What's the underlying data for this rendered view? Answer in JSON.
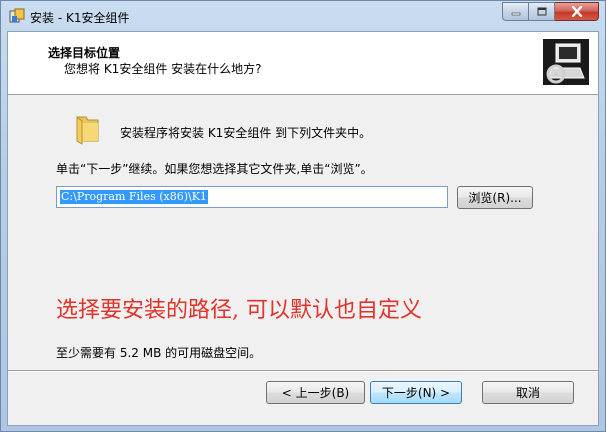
{
  "window": {
    "title": "安装 - K1安全组件",
    "icon": "setup-icon",
    "controls": [
      "minimize-icon",
      "maximize-icon",
      "close-icon"
    ],
    "close_color": "#c5392b"
  },
  "header": {
    "title": "选择目标位置",
    "subtitle": "您想将 K1安全组件 安装在什么地方?",
    "logo": "installer-computer-icon"
  },
  "body": {
    "folder_icon": "folder-icon",
    "install_line": "安装程序将安装 K1安全组件 到下列文件夹中。",
    "instruction": "单击“下一步”继续。如果您想选择其它文件夹,单击“浏览”。",
    "path_value": "C:\\Program Files (x86)\\K1",
    "browse_label": "浏览(R)...",
    "annotation": "选择要安装的路径,  可以默认也自定义",
    "annotation_color": "#e0342b",
    "space_required": "至少需要有 5.2 MB 的可用磁盘空间。"
  },
  "footer": {
    "back_label": "< 上一步(B)",
    "next_label": "下一步(N) >",
    "cancel_label": "取消"
  }
}
